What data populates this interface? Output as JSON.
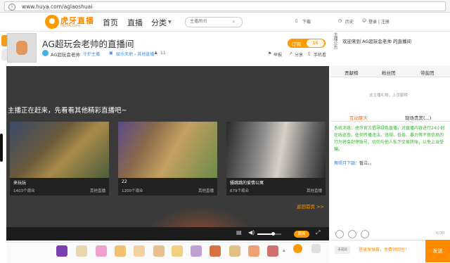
{
  "browser": {
    "url": "www.huya.com/aglaoshuai"
  },
  "header": {
    "logo_text": "虎牙直播",
    "logo_sub": "HUYA.com",
    "nav": [
      "首页",
      "直播",
      "分类"
    ],
    "search_placeholder": "主播房间",
    "tools": {
      "download": "下载",
      "history": "历史",
      "login": "登录 | 注册"
    }
  },
  "room": {
    "title": "AG超玩会老帅的直播间",
    "anchor_name": "AG超玩会老帅",
    "guard": "守护主播",
    "category_path": "娱乐天地 › 其他直播",
    "viewers": "11",
    "subscribe_label": "订阅",
    "subscribe_count": "16",
    "actions": {
      "report": "举报",
      "share": "分享",
      "mobile": "手机看"
    }
  },
  "video": {
    "offline_text": "主播正在赶来，先看看其他精彩直播吧~",
    "back_home": "返回首页 >>",
    "quality": "原画",
    "cards": [
      {
        "name": "来玩玩",
        "viewers": "1403个观众",
        "category": "其他直播"
      },
      {
        "name": "22",
        "viewers": "1200个观众",
        "category": "其他直播"
      },
      {
        "name": "骚跳跳的爱情公寓",
        "viewers": "679个观众",
        "category": "其他直播"
      }
    ]
  },
  "right_panel": {
    "side_label": "主播公告",
    "welcome": "欢迎来到 AG超玩会老帅 的直播间",
    "rank_tabs": [
      "贡献榜",
      "粉丝团",
      "带盐团"
    ],
    "rank_empty": "这主播礼物，上贡献榜",
    "chat_tabs": [
      "互动聊天",
      "现场贵宾(...)"
    ],
    "system_message": "系统消息：虎牙官方倡导绿色直播，对直播内容进行24小时在线巡查。任何传播违法、违规、低俗、暴力等不良信息的行为将会封停账号。切勿与他人私下交易转账，以免上当受骗。",
    "user_message": {
      "user": "舞照月下鼬：",
      "text": "暂泣。。"
    },
    "counter": "0/30",
    "input_badge": "未成就",
    "input_hint": "登录发弹幕，免费领回豆！",
    "send_label": "发送"
  },
  "colors": {
    "brand_orange": "#ff9b00",
    "system_green": "#2db52a",
    "video_bg": "#3a3a3a"
  }
}
